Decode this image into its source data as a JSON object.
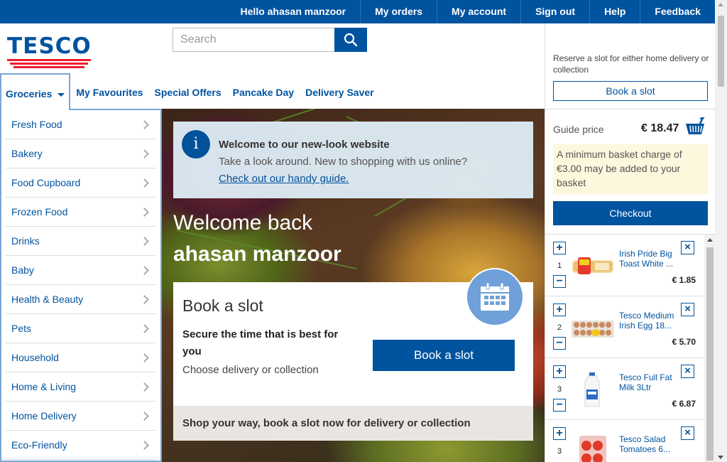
{
  "topnav": {
    "greeting": "Hello ahasan manzoor",
    "my_orders": "My orders",
    "my_account": "My account",
    "sign_out": "Sign out",
    "help": "Help",
    "feedback": "Feedback"
  },
  "logo": {
    "text": "TESCO"
  },
  "search": {
    "placeholder": "Search"
  },
  "catnav": {
    "groceries": "Groceries",
    "favourites": "My Favourites",
    "offers": "Special Offers",
    "pancake": "Pancake Day",
    "delivery_saver": "Delivery Saver"
  },
  "leftmenu": {
    "items": [
      "Fresh Food",
      "Bakery",
      "Food Cupboard",
      "Frozen Food",
      "Drinks",
      "Baby",
      "Health & Beauty",
      "Pets",
      "Household",
      "Home & Living",
      "Home Delivery",
      "Eco-Friendly"
    ]
  },
  "welcome": {
    "title": "Welcome to our new-look website",
    "text": "Take a look around. New to shopping with us online?",
    "link": "Check out our handy guide."
  },
  "greeting": {
    "line1": "Welcome back",
    "name": "ahasan manzoor"
  },
  "slot_card": {
    "title": "Book a slot",
    "subtitle": "Secure the time that is best for you",
    "desc": "Choose delivery or collection",
    "button": "Book a slot",
    "footer": "Shop your way, book a slot now for delivery or collection"
  },
  "right": {
    "reserve_text": "Reserve a slot for either home delivery or collection",
    "book_button": "Book a slot",
    "guide_label": "Guide price",
    "guide_value": "€ 18.47",
    "notice": "A minimum basket charge of €3.00 may be added to your basket",
    "checkout": "Checkout"
  },
  "basket": [
    {
      "name1": "Irish Pride Big",
      "name2": "Toast White ...",
      "qty": "1",
      "price": "€ 1.85"
    },
    {
      "name1": "Tesco Medium",
      "name2": "Irish Egg 18...",
      "qty": "2",
      "price": "€ 5.70"
    },
    {
      "name1": "Tesco Full Fat",
      "name2": "Milk 3Ltr",
      "qty": "3",
      "price": "€ 6.87"
    },
    {
      "name1": "Tesco Salad",
      "name2": "Tomatoes 6...",
      "qty": "3",
      "price": ""
    }
  ],
  "colors": {
    "brand_blue": "#00539f",
    "brand_red": "#ee1c2e",
    "notice_bg": "#fdf7dd"
  },
  "icons": {
    "search": "search-icon",
    "info": "info-icon",
    "calendar": "calendar-icon",
    "basket": "basket-icon",
    "chevron": "chevron-right-icon",
    "caret": "caret-down-icon",
    "close": "close-icon",
    "plus": "plus-icon",
    "minus": "minus-icon"
  }
}
